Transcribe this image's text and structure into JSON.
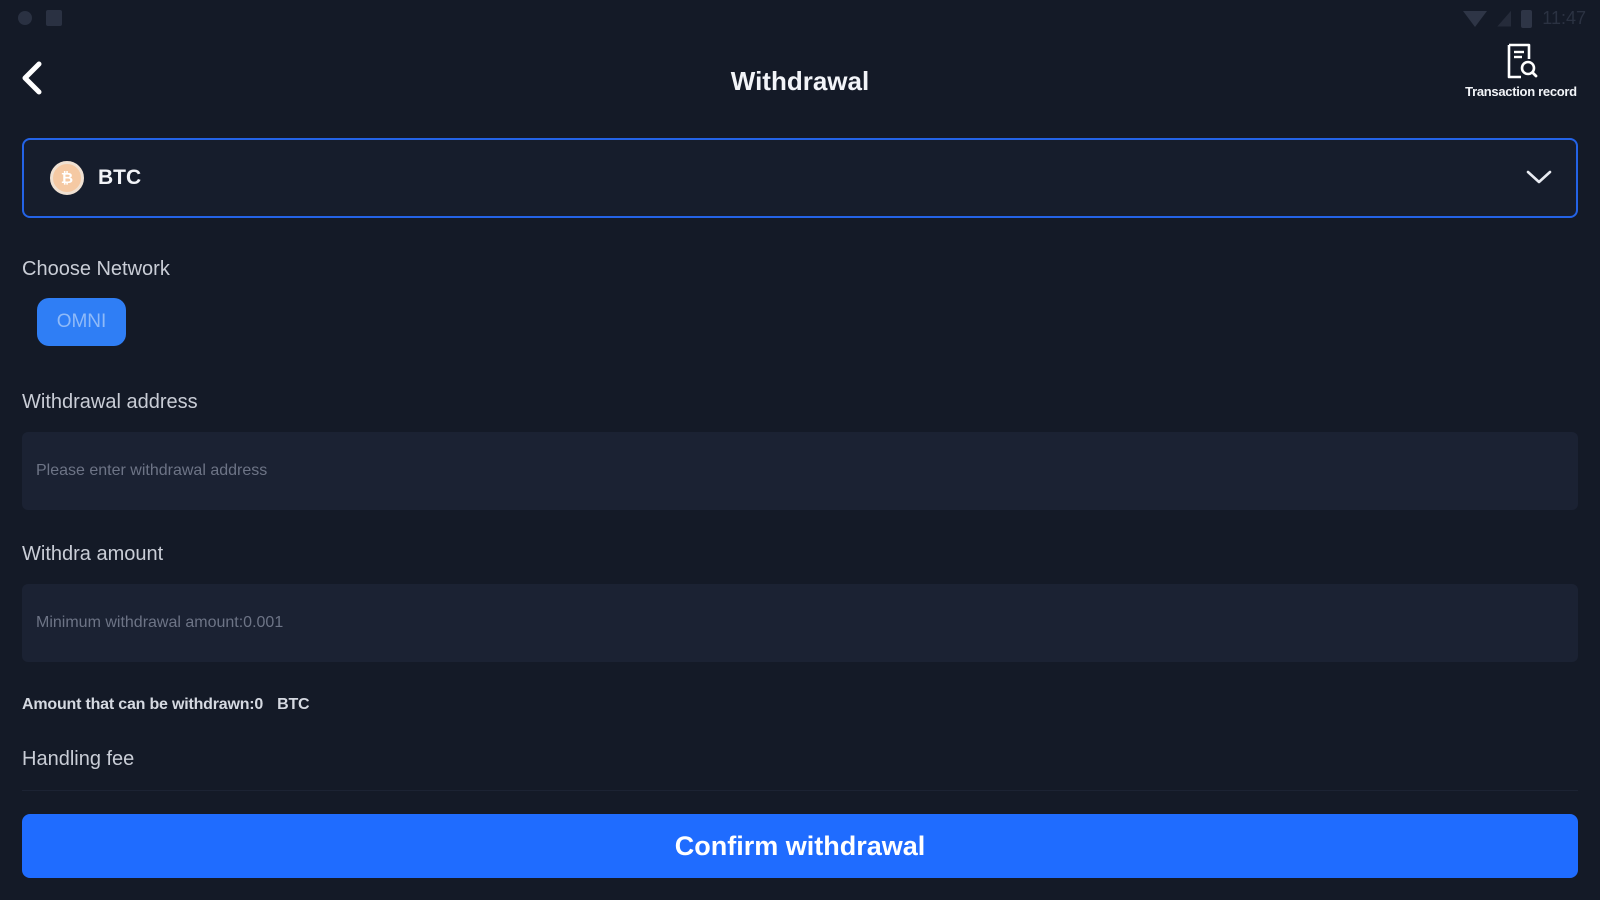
{
  "status_bar": {
    "time": "11:47",
    "icons": [
      "notification-icon",
      "sim-icon",
      "wifi-icon",
      "signal-icon",
      "battery-icon"
    ]
  },
  "header": {
    "title": "Withdrawal",
    "back_icon": "chevron-left-icon",
    "transaction_record_label": "Transaction record",
    "transaction_record_icon": "receipt-search-icon"
  },
  "coin_selector": {
    "coin": "BTC",
    "coin_icon_glyph": "₿",
    "chevron_icon": "chevron-down-icon"
  },
  "network": {
    "label": "Choose Network",
    "options": [
      {
        "label": "OMNI",
        "selected": true
      }
    ]
  },
  "withdrawal_address": {
    "label": "Withdrawal address",
    "value": "",
    "placeholder": "Please enter withdrawal address"
  },
  "amount": {
    "label": "Withdra amount",
    "value": "",
    "placeholder": "Minimum withdrawal amount:0.001"
  },
  "available": {
    "text": "Amount that can be withdrawn:0",
    "unit": "BTC"
  },
  "handling_fee": {
    "label": "Handling fee"
  },
  "confirm_button": {
    "label": "Confirm withdrawal"
  },
  "colors": {
    "background": "#141a27",
    "accent": "#1f6cff",
    "chip": "#2f7ef5",
    "input_bg": "#1b2233",
    "coin_border": "#2463e6"
  }
}
